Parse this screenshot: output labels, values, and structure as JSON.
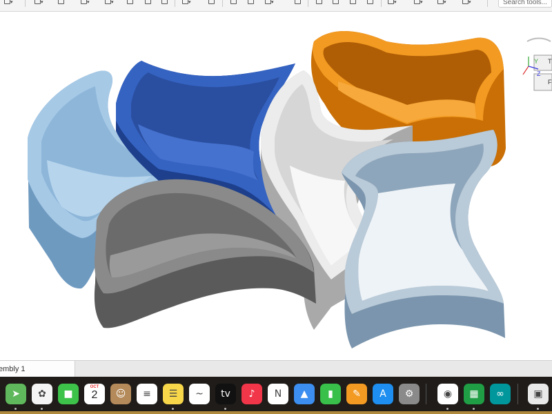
{
  "toolbar": {
    "search_placeholder": "Search tools..."
  },
  "tabs": [
    {
      "label": "embly 1"
    }
  ],
  "viewcube": {
    "front_label": "F",
    "top_label": "T",
    "z_axis": "Z",
    "y_axis": "Y"
  },
  "colors": {
    "light_blue_tray": "#8fb8dc",
    "dark_blue_tray": "#2d55a8",
    "orange_tray": "#e8890f",
    "white_tray": "#e6e6e6",
    "grey_tray": "#7a7a7a",
    "pale_blue_tray": "#b9cad8"
  },
  "dock": {
    "apps": [
      {
        "name": "Maps",
        "icon": "maps-icon",
        "glyph": "➤",
        "color": "#5fb85b"
      },
      {
        "name": "Photos",
        "icon": "photos-icon",
        "glyph": "✿",
        "color": "#f4f4f4"
      },
      {
        "name": "FaceTime",
        "icon": "facetime-icon",
        "glyph": "■",
        "color": "#3ec34a"
      },
      {
        "name": "Calendar",
        "icon": "calendar-icon",
        "month": "OCT",
        "day": "2",
        "color": "#ffffff"
      },
      {
        "name": "Contacts",
        "icon": "contacts-icon",
        "glyph": "☺",
        "color": "#b48a5a"
      },
      {
        "name": "Reminders",
        "icon": "reminders-icon",
        "glyph": "≡",
        "color": "#ffffff"
      },
      {
        "name": "Notes",
        "icon": "notes-icon",
        "glyph": "☰",
        "color": "#f7d64a"
      },
      {
        "name": "Freeform",
        "icon": "freeform-icon",
        "glyph": "~",
        "color": "#ffffff"
      },
      {
        "name": "Apple TV",
        "icon": "appletv-icon",
        "glyph": "tv",
        "color": "#111111"
      },
      {
        "name": "Music",
        "icon": "music-icon",
        "glyph": "♪",
        "color": "#f2364a"
      },
      {
        "name": "News",
        "icon": "news-icon",
        "glyph": "N",
        "color": "#ffffff"
      },
      {
        "name": "Keynote",
        "icon": "keynote-icon",
        "glyph": "▲",
        "color": "#3c8ef0"
      },
      {
        "name": "Numbers",
        "icon": "numbers-icon",
        "glyph": "▮",
        "color": "#39c04a"
      },
      {
        "name": "Pages",
        "icon": "pages-icon",
        "glyph": "✎",
        "color": "#f39a22"
      },
      {
        "name": "App Store",
        "icon": "appstore-icon",
        "glyph": "A",
        "color": "#1e8ff0"
      },
      {
        "name": "System Settings",
        "icon": "settings-icon",
        "glyph": "⚙",
        "color": "#8a8a8a"
      },
      {
        "name": "Chrome",
        "icon": "chrome-icon",
        "glyph": "◉",
        "color": "#ffffff"
      },
      {
        "name": "Onshape",
        "icon": "onshape-icon",
        "glyph": "▦",
        "color": "#1f9e45"
      },
      {
        "name": "Arduino",
        "icon": "arduino-icon",
        "glyph": "∞",
        "color": "#00979c"
      },
      {
        "name": "Preview",
        "icon": "preview-icon",
        "glyph": "▣",
        "color": "#e9e9e9"
      }
    ]
  }
}
